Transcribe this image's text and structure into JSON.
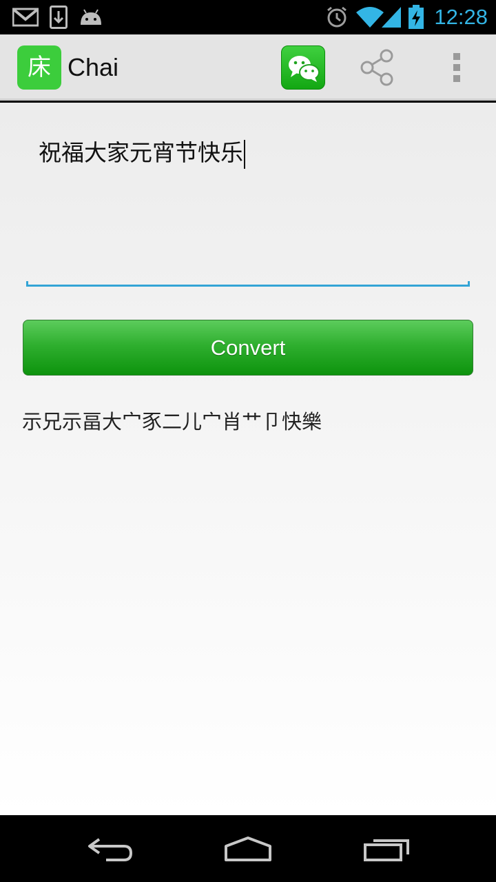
{
  "status_bar": {
    "time": "12:28",
    "clock_color": "#33b5e5",
    "left_icons": [
      "gmail-icon",
      "download-icon",
      "android-icon"
    ],
    "right_icons": [
      "alarm-icon",
      "wifi-icon",
      "signal-icon",
      "battery-charging-icon"
    ]
  },
  "action_bar": {
    "app_icon_glyph": "床",
    "app_title": "Chai",
    "actions": [
      "wechat-share",
      "share",
      "overflow-menu"
    ]
  },
  "input": {
    "value": "祝福大家元宵节快乐",
    "underline_color": "#33a4d6"
  },
  "convert_button": {
    "label": "Convert",
    "color": "#1fa31f"
  },
  "output": {
    "text": "示兄示畐大宀豕二儿宀肖艹卩快樂"
  },
  "nav_bar": {
    "buttons": [
      "back",
      "home",
      "recent-apps"
    ]
  }
}
